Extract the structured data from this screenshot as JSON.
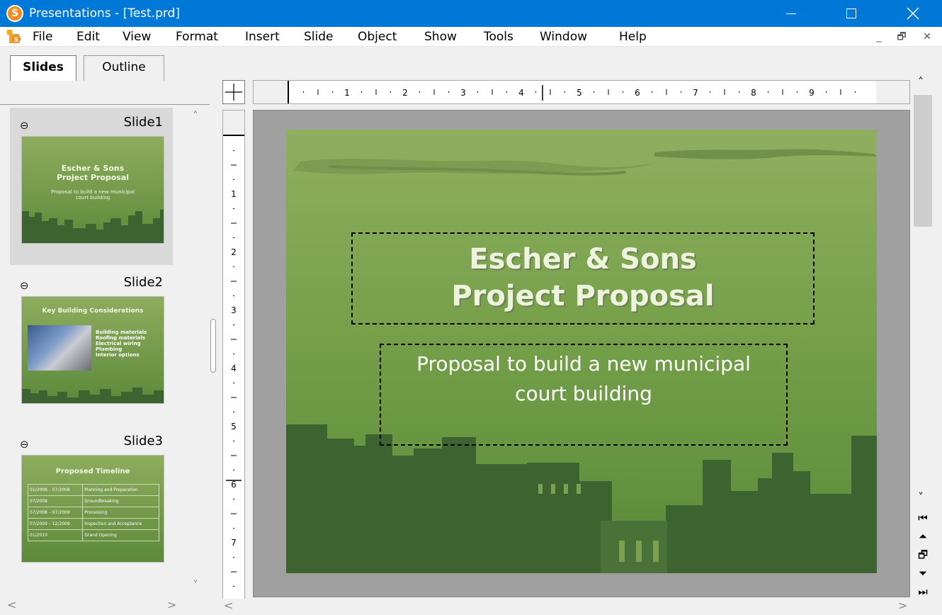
{
  "window": {
    "app_icon_letter": "S",
    "title": "Presentations - [Test.prd]",
    "controls": {
      "minimize": "minimize",
      "maximize": "maximize",
      "close": "close"
    }
  },
  "menu": {
    "items": [
      "File",
      "Edit",
      "View",
      "Format",
      "Insert",
      "Slide",
      "Object",
      "Show",
      "Tools",
      "Window",
      "Help"
    ],
    "mdi_minimize": "_",
    "mdi_restore": "🗗",
    "mdi_close": "✕"
  },
  "left_pane": {
    "tabs": [
      "Slides",
      "Outline"
    ],
    "active_tab": "Slides",
    "thumbnails": [
      {
        "name": "Slide1",
        "title_line1": "Escher & Sons",
        "title_line2": "Project Proposal",
        "subtitle_line1": "Proposal to build a new municipal",
        "subtitle_line2": "court building"
      },
      {
        "name": "Slide2",
        "title": "Key Building Considerations",
        "bullets": [
          "Building materials",
          "Roofing materials",
          "Electrical wiring",
          "Plumbing",
          "Interior options"
        ]
      },
      {
        "name": "Slide3",
        "title": "Proposed Timeline",
        "rows": [
          [
            "01/2008 – 07/2008",
            "Planning and Preparation"
          ],
          [
            "07/2008",
            "Groundbreaking"
          ],
          [
            "07/2008 – 07/2009",
            "Processing"
          ],
          [
            "07/2009 – 12/2009",
            "Inspection and Acceptance"
          ],
          [
            "01/2010",
            "Grand Opening"
          ]
        ]
      }
    ]
  },
  "rulers": {
    "horizontal_labels": [
      "1",
      "2",
      "3",
      "4",
      "5",
      "6",
      "7",
      "8",
      "9"
    ],
    "vertical_labels": [
      "1",
      "2",
      "3",
      "4",
      "5",
      "6",
      "7"
    ]
  },
  "slide": {
    "title_line1": "Escher & Sons",
    "title_line2": "Project Proposal",
    "subtitle_line1": "Proposal to build a new municipal",
    "subtitle_line2": "court building",
    "colors": {
      "background_top": "#8faf60",
      "background_bottom": "#5a8a38",
      "skyline": "#3d6330",
      "title_text": "#eef4dc"
    }
  },
  "colors": {
    "titlebar": "#0078d7",
    "workspace": "#a0a0a0"
  }
}
